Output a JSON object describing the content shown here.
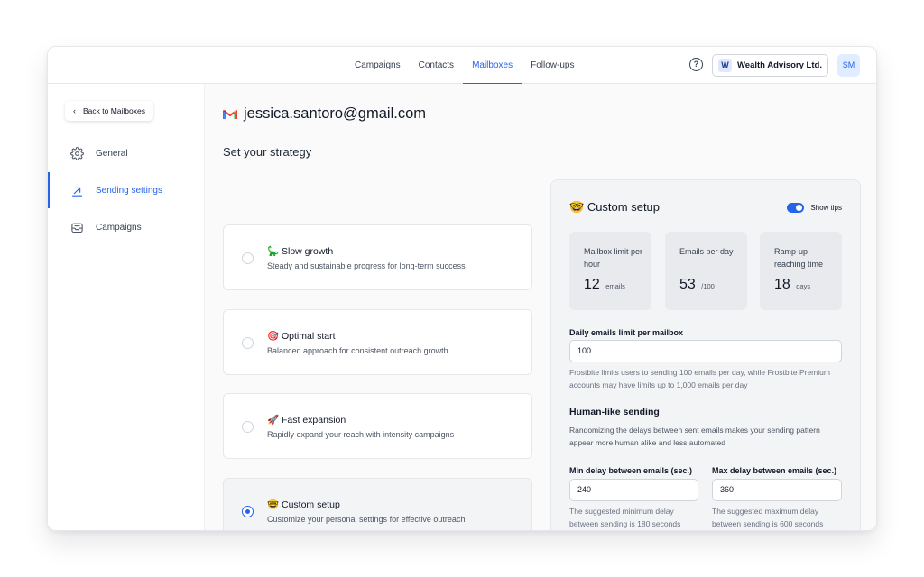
{
  "topnav": {
    "items": [
      {
        "label": "Campaigns",
        "active": false
      },
      {
        "label": "Contacts",
        "active": false
      },
      {
        "label": "Mailboxes",
        "active": true
      },
      {
        "label": "Follow-ups",
        "active": false
      }
    ],
    "help": "?",
    "workspace": {
      "badge": "W",
      "name": "Wealth Advisory Ltd."
    },
    "avatar": "SM"
  },
  "sidebar": {
    "back_label": "Back to Mailboxes",
    "items": [
      {
        "label": "General",
        "icon": "gear-icon"
      },
      {
        "label": "Sending settings",
        "icon": "send-arrow-icon",
        "active": true
      },
      {
        "label": "Campaigns",
        "icon": "inbox-icon"
      }
    ]
  },
  "main": {
    "email": "jessica.santoro@gmail.com",
    "strategy_heading": "Set your strategy",
    "options": [
      {
        "emoji": "🦕",
        "title": "Slow growth",
        "desc": "Steady and sustainable progress for long-term success",
        "selected": false
      },
      {
        "emoji": "🎯",
        "title": "Optimal start",
        "desc": "Balanced approach for consistent outreach growth",
        "selected": false
      },
      {
        "emoji": "🚀",
        "title": "Fast expansion",
        "desc": "Rapidly expand your reach with intensity campaigns",
        "selected": false
      },
      {
        "emoji": "🤓",
        "title": "Custom setup",
        "desc": "Customize your personal settings for effective outreach",
        "selected": true
      }
    ]
  },
  "panel": {
    "emoji": "🤓",
    "title": "Custom setup",
    "tips_label": "Show tips",
    "tips_on": true,
    "stats": [
      {
        "label": "Mailbox limit per hour",
        "value": "12",
        "unit": "emails"
      },
      {
        "label": "Emails per day",
        "value": "53",
        "unit": "/100"
      },
      {
        "label": "Ramp-up reaching time",
        "value": "18",
        "unit": "days"
      }
    ],
    "daily_limit": {
      "label": "Daily emails limit per mailbox",
      "value": "100",
      "help": "Frostbite limits users to sending 100 emails per day, while Frostbite Premium accounts may have limits up to 1,000 emails per day"
    },
    "human": {
      "heading": "Human-like sending",
      "desc": "Randomizing the delays between sent emails makes your sending pattern appear more human alike and less automated"
    },
    "min_delay": {
      "label": "Min delay between emails (sec.)",
      "value": "240",
      "help": "The suggested minimum delay between sending is 180 seconds"
    },
    "max_delay": {
      "label": "Max delay between emails (sec.)",
      "value": "360",
      "help": "The suggested maximum delay between sending is 600 seconds"
    }
  }
}
